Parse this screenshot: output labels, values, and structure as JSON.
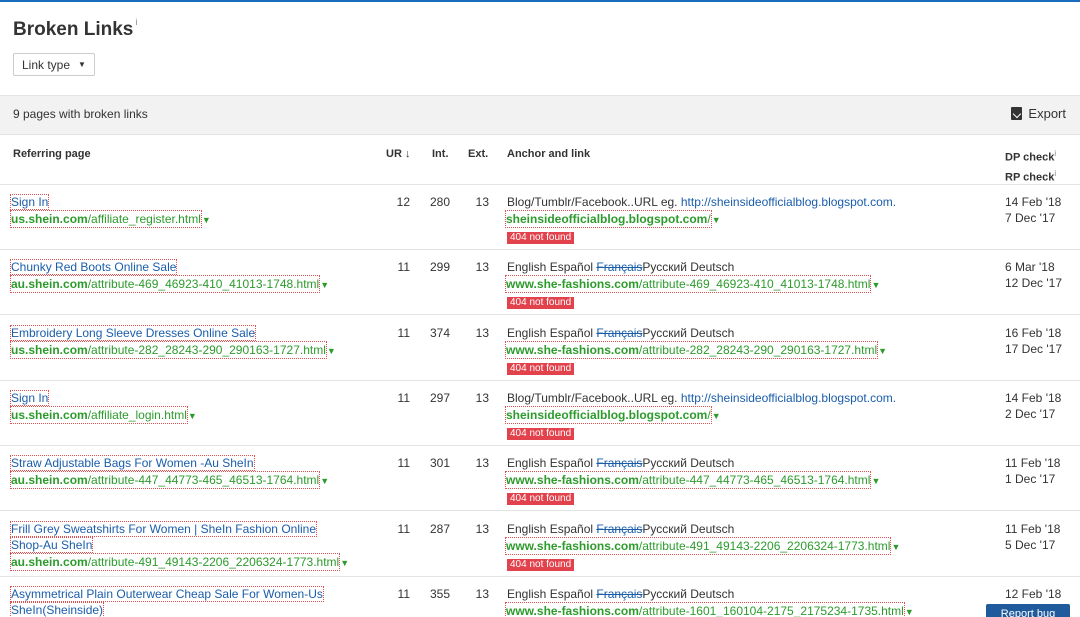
{
  "title": "Broken Links",
  "title_info": "i",
  "link_type": "Link type",
  "summary": "9 pages with broken links",
  "export_label": "Export",
  "headers": {
    "referring_page": "Referring page",
    "ur": "UR",
    "ur_sort": "↓",
    "int": "Int.",
    "ext": "Ext.",
    "anchor": "Anchor and link",
    "dp_check": "DP check",
    "rp_check": "RP check",
    "info": "i"
  },
  "rows": [
    {
      "title": "Sign In",
      "title2": "",
      "domain": "us.shein.com",
      "path": "/affiliate_register.html",
      "ur": "12",
      "int": "280",
      "ext": "13",
      "anchor_a": "Blog/Tumblr/Facebook..URL eg. ",
      "anchor_b": "",
      "anchor_c": "http://sheinsideofficialblog.blogspot.com.",
      "link_domain": "sheinsideofficialblog.blogspot.com",
      "link_path": "/",
      "status": "404 not found",
      "dp": "14 Feb '18",
      "rp": "7 Dec '17"
    },
    {
      "title": "Chunky Red Boots Online Sale",
      "title2": "",
      "domain": "au.shein.com",
      "path": "/attribute-469_46923-410_41013-1748.html",
      "ur": "11",
      "int": "299",
      "ext": "13",
      "anchor_a": "English Español ",
      "anchor_b": "Français",
      "anchor_c": "Русский Deutsch",
      "link_domain": "www.she-fashions.com",
      "link_path": "/attribute-469_46923-410_41013-1748.html",
      "status": "404 not found",
      "dp": "6 Mar '18",
      "rp": "12 Dec '17"
    },
    {
      "title": "Embroidery Long Sleeve Dresses Online Sale",
      "title2": "",
      "domain": "us.shein.com",
      "path": "/attribute-282_28243-290_290163-1727.html",
      "ur": "11",
      "int": "374",
      "ext": "13",
      "anchor_a": "English Español ",
      "anchor_b": "Français",
      "anchor_c": "Русский Deutsch",
      "link_domain": "www.she-fashions.com",
      "link_path": "/attribute-282_28243-290_290163-1727.html",
      "status": "404 not found",
      "dp": "16 Feb '18",
      "rp": "17 Dec '17"
    },
    {
      "title": "Sign In",
      "title2": "",
      "domain": "us.shein.com",
      "path": "/affiliate_login.html",
      "ur": "11",
      "int": "297",
      "ext": "13",
      "anchor_a": "Blog/Tumblr/Facebook..URL eg. ",
      "anchor_b": "",
      "anchor_c": "http://sheinsideofficialblog.blogspot.com.",
      "link_domain": "sheinsideofficialblog.blogspot.com",
      "link_path": "/",
      "status": "404 not found",
      "dp": "14 Feb '18",
      "rp": "2 Dec '17"
    },
    {
      "title": "Straw Adjustable Bags For Women -Au SheIn",
      "title2": "",
      "domain": "au.shein.com",
      "path": "/attribute-447_44773-465_46513-1764.html",
      "ur": "11",
      "int": "301",
      "ext": "13",
      "anchor_a": "English Español ",
      "anchor_b": "Français",
      "anchor_c": "Русский Deutsch",
      "link_domain": "www.she-fashions.com",
      "link_path": "/attribute-447_44773-465_46513-1764.html",
      "status": "404 not found",
      "dp": "11 Feb '18",
      "rp": "1 Dec '17"
    },
    {
      "title": "Frill Grey Sweatshirts For Women | SheIn Fashion Online",
      "title2": "Shop-Au SheIn",
      "domain": "au.shein.com",
      "path": "/attribute-491_49143-2206_2206324-1773.html",
      "ur": "11",
      "int": "287",
      "ext": "13",
      "anchor_a": "English Español ",
      "anchor_b": "Français",
      "anchor_c": "Русский Deutsch",
      "link_domain": "www.she-fashions.com",
      "link_path": "/attribute-491_49143-2206_2206324-1773.html",
      "status": "404 not found",
      "dp": "11 Feb '18",
      "rp": "5 Dec '17"
    },
    {
      "title": "Asymmetrical Plain Outerwear Cheap Sale For Women-Us",
      "title2": "SheIn(Sheinside)",
      "domain": "",
      "path": "",
      "ur": "11",
      "int": "355",
      "ext": "13",
      "anchor_a": "English Español ",
      "anchor_b": "Français",
      "anchor_c": "Русский Deutsch",
      "link_domain": "www.she-fashions.com",
      "link_path": "/attribute-1601_160104-2175_2175234-1735.html",
      "status": "",
      "dp": "12 Feb '18",
      "rp": ""
    }
  ],
  "report_bug": "Report bug"
}
